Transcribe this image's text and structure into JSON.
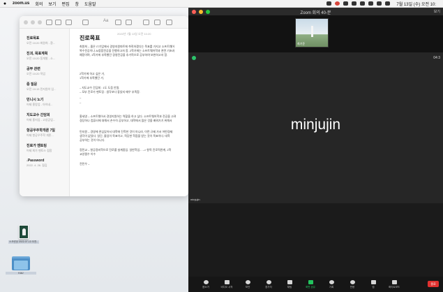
{
  "menubar": {
    "app_name": "zoom.us",
    "menus": [
      "회의",
      "보기",
      "편집",
      "창",
      "도움말"
    ],
    "clock": "7월 13일 (수) 오전 10:"
  },
  "notes": {
    "items": [
      {
        "title": "진로목표",
        "meta": "오전 10:20  최원희 - 환..."
      },
      {
        "title": "진괴, 목표계획",
        "meta": "오전 10:20  동개발 - 소..."
      },
      {
        "title": "공부 관련",
        "meta": "오전 10:20  직업"
      },
      {
        "title": "중 질문",
        "meta": "오전 10:15  민지원이 입..."
      },
      {
        "title": "민니시 노기",
        "meta": "어제  흥망업 - 아이네..."
      },
      {
        "title": "지도교수 간담회",
        "meta": "어제  홍지업 - 고성공업..."
      },
      {
        "title": "항공우주학개론 7일",
        "meta": "어제  항공우주학 개론..."
      },
      {
        "title": "진로가 멘토링",
        "meta": "어제  최가 멘토스 접함"
      },
      {
        "title": "Password",
        "meta": "2022. 4. 26.  잠김"
      }
    ],
    "editor": {
      "timestamp": "2022년 7월 13일 오전 10:20",
      "heading": "진로목표",
      "lines": [
        "최원희 – 졸은 IT기업에서 경영지원파트에 취직하겠다는 목표를 가지고 소프트웨어",
        "복수전공이나 AI융합전공을 진행하고자 함. 2학기에는 소프트웨어학과 관련 기초과",
        "예정이며, 1학기에 부족했던 경영전공을 추가적으로 공부하여 보완하고자 함.",
        "2학기에 하고 싶은 거,",
        "1학기에 부족했던 거,",
        "–  지도교수 간담회 : 1도 도움 안됨.",
        "–  모부 진로가 멘토링 : 생각보다 좋았지 매우 부족함.",
        "–",
        "–",
        "홍세영 – 소프트웨어서 경영지원하는 역할을 하고 싶다. 소프트웨어학과 전공을 고려",
        "경당하나 컴퓨터에 대해서 손수히 공부하고, 대학에서 많은 것을 배워가기 위해서",
        "민지원 – 경영에 관심있어서 대학에 진학한 것이 아니라, 이런 규제 가서 어떤경제",
        "생각이 없었다. 일단, 졸업이 목표이고, 적당한 학점을 받는 것이 목표이다. 대학",
        "공부하는 것이 아니다.",
        "정민교 – 항공정비학으로 진로를 설계중임. 일반학업... –> 항목 진로적관계, 2학",
        "교양필수 이수",
        "전민우 –"
      ]
    }
  },
  "desktop_icons": [
    {
      "label": "스크린샷 2022-07-13 오전..."
    },
    {
      "label": "KAU"
    }
  ],
  "zoom": {
    "window_title": "Zoom 회의  40-분",
    "view_label": "보기",
    "thumbnail_name": "최기준",
    "speaker_name": "minjujin",
    "speaker_label": "minjujin",
    "timer": "04:3",
    "controls": [
      {
        "label": "음소거"
      },
      {
        "label": "비디오 시작"
      },
      {
        "label": "보안"
      },
      {
        "label": "참가자"
      },
      {
        "label": "채팅"
      },
      {
        "label": "화면 공유"
      },
      {
        "label": "기록"
      },
      {
        "label": "반응"
      },
      {
        "label": "앱"
      },
      {
        "label": "화이트보드"
      }
    ],
    "end_label": "종료",
    "colors": {
      "share_green": "#23c45e",
      "end_red": "#e0312f"
    }
  }
}
